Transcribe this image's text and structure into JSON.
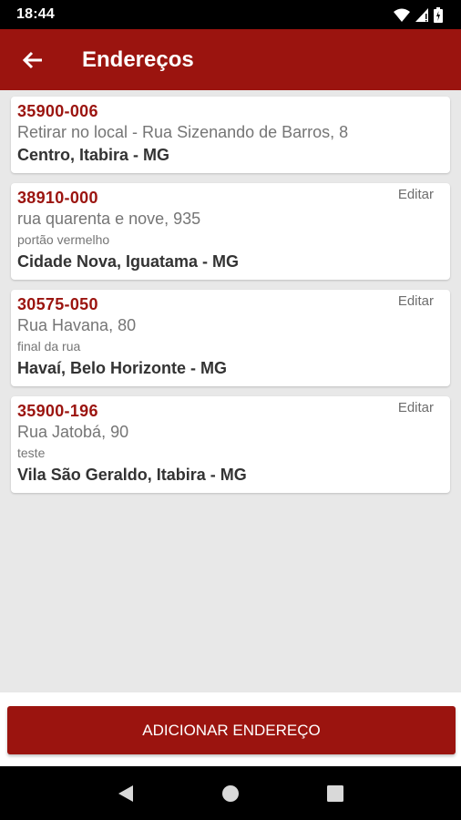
{
  "status_bar": {
    "time": "18:44"
  },
  "app_bar": {
    "title": "Endereços"
  },
  "addresses": [
    {
      "cep": "35900-006",
      "street": "Retirar no local - Rua Sizenando de Barros, 8",
      "complement": "",
      "city": "Centro, Itabira - MG",
      "edit_label": ""
    },
    {
      "cep": "38910-000",
      "street": "rua quarenta e nove, 935",
      "complement": "portão vermelho",
      "city": "Cidade Nova, Iguatama - MG",
      "edit_label": "Editar"
    },
    {
      "cep": "30575-050",
      "street": "Rua Havana, 80",
      "complement": "final da rua",
      "city": "Havaí, Belo Horizonte - MG",
      "edit_label": "Editar"
    },
    {
      "cep": "35900-196",
      "street": "Rua Jatobá, 90",
      "complement": "teste",
      "city": "Vila São Geraldo, Itabira - MG",
      "edit_label": "Editar"
    }
  ],
  "add_button": {
    "label": "ADICIONAR ENDEREÇO"
  },
  "colors": {
    "primary": "#9b140f",
    "background": "#e8e8e8",
    "card": "#ffffff"
  },
  "icons": {
    "back": "arrow-left-icon",
    "wifi": "wifi-icon",
    "signal": "signal-icon",
    "battery": "battery-icon"
  }
}
